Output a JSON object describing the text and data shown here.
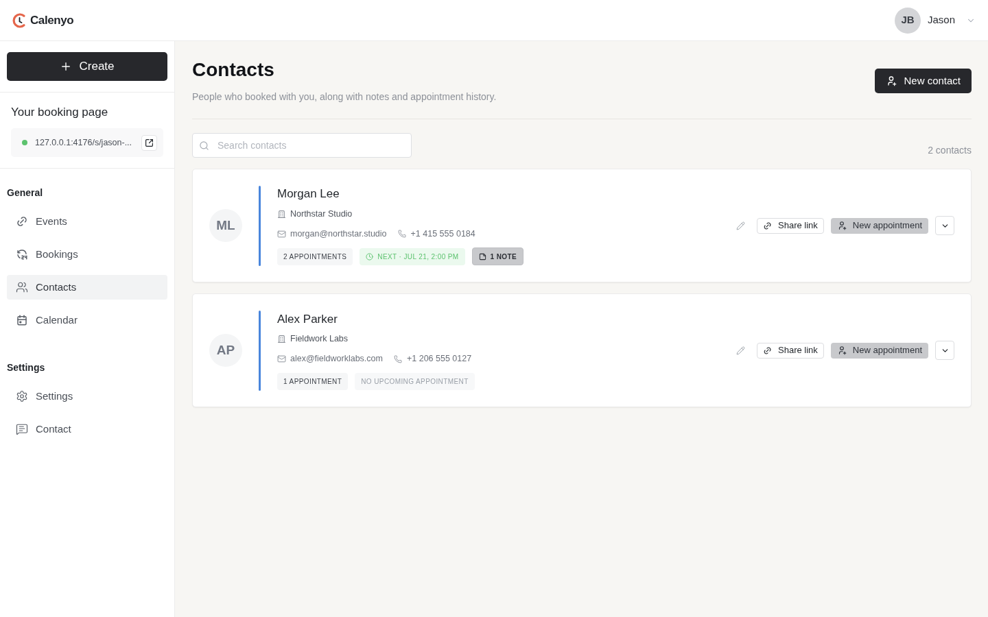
{
  "brand": {
    "name": "Calenyo"
  },
  "user": {
    "initials": "JB",
    "name": "Jason"
  },
  "sidebar": {
    "create_button": "Create",
    "booking_page": {
      "title": "Your booking page",
      "url": "127.0.0.1:4176/s/jason-...",
      "online": true
    },
    "sections": [
      {
        "heading": "General",
        "items": [
          {
            "label": "Events",
            "selected": false
          },
          {
            "label": "Bookings",
            "selected": false
          },
          {
            "label": "Contacts",
            "selected": true
          },
          {
            "label": "Calendar",
            "selected": false
          }
        ]
      },
      {
        "heading": "Settings",
        "items": [
          {
            "label": "Settings",
            "selected": false
          },
          {
            "label": "Contact",
            "selected": false
          }
        ]
      }
    ]
  },
  "page": {
    "title": "Contacts",
    "subtitle": "People who booked with you, along with notes and appointment history.",
    "new_contact_button": "New contact",
    "search": {
      "placeholder": "Search contacts"
    },
    "count": "2 contacts"
  },
  "contacts": [
    {
      "initials": "ML",
      "name": "Morgan Lee",
      "company": "Northstar Studio",
      "email": "morgan@northstar.studio",
      "phone": "+1 415 555 0184",
      "badges": [
        {
          "kind": "count",
          "text": "2 APPOINTMENTS"
        },
        {
          "kind": "next",
          "text": "NEXT · JUL 21, 2:00 PM"
        },
        {
          "kind": "note",
          "text": "1 NOTE"
        }
      ],
      "share_button": "Share link",
      "appointment_button": "New appointment"
    },
    {
      "initials": "AP",
      "name": "Alex Parker",
      "company": "Fieldwork Labs",
      "email": "alex@fieldworklabs.com",
      "phone": "+1 206 555 0127",
      "badges": [
        {
          "kind": "count",
          "text": "1 APPOINTMENT"
        },
        {
          "kind": "none",
          "text": "NO UPCOMING APPOINTMENT"
        }
      ],
      "share_button": "Share link",
      "appointment_button": "New appointment"
    }
  ]
}
